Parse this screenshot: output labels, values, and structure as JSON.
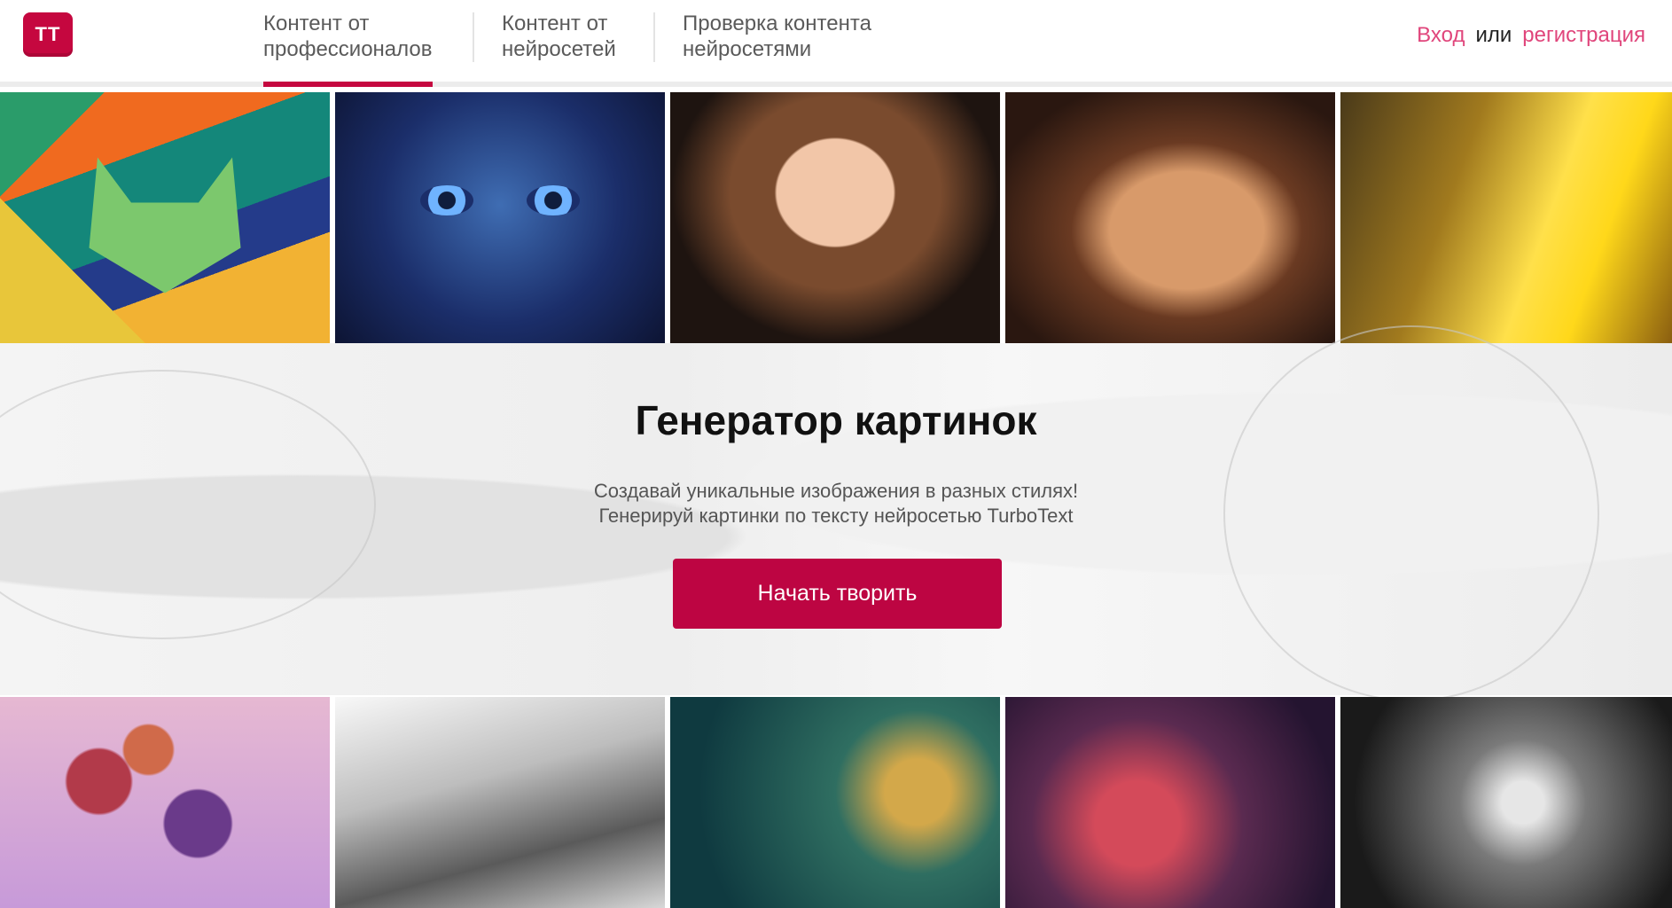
{
  "logo": {
    "text": "ТТ"
  },
  "nav": {
    "tabs": [
      {
        "line1": "Контент от",
        "line2": "профессионалов",
        "active": true
      },
      {
        "line1": "Контент от",
        "line2": "нейросетей",
        "active": false
      },
      {
        "line1": "Проверка контента",
        "line2": "нейросетями",
        "active": false
      }
    ]
  },
  "auth": {
    "login": "Вход",
    "or": "или",
    "register": "регистрация"
  },
  "hero": {
    "title": "Генератор картинок",
    "subtitle_line1": "Создавай уникальные изображения в разных стилях!",
    "subtitle_line2": "Генерируй картинки по тексту нейросетью TurboText",
    "button": "Начать творить"
  },
  "colors": {
    "brand": "#c5073f",
    "button": "#bd0542",
    "link": "#e0457b"
  },
  "gallery": {
    "top": [
      "cubist-cat",
      "blue-face-child",
      "girl-with-braids",
      "fluffy-persian-cat",
      "golden-city-street"
    ],
    "bottom": [
      "balloons",
      "pencil-mountains",
      "steampunk-submarine",
      "gift-box-girl",
      "lightning-portrait"
    ]
  }
}
